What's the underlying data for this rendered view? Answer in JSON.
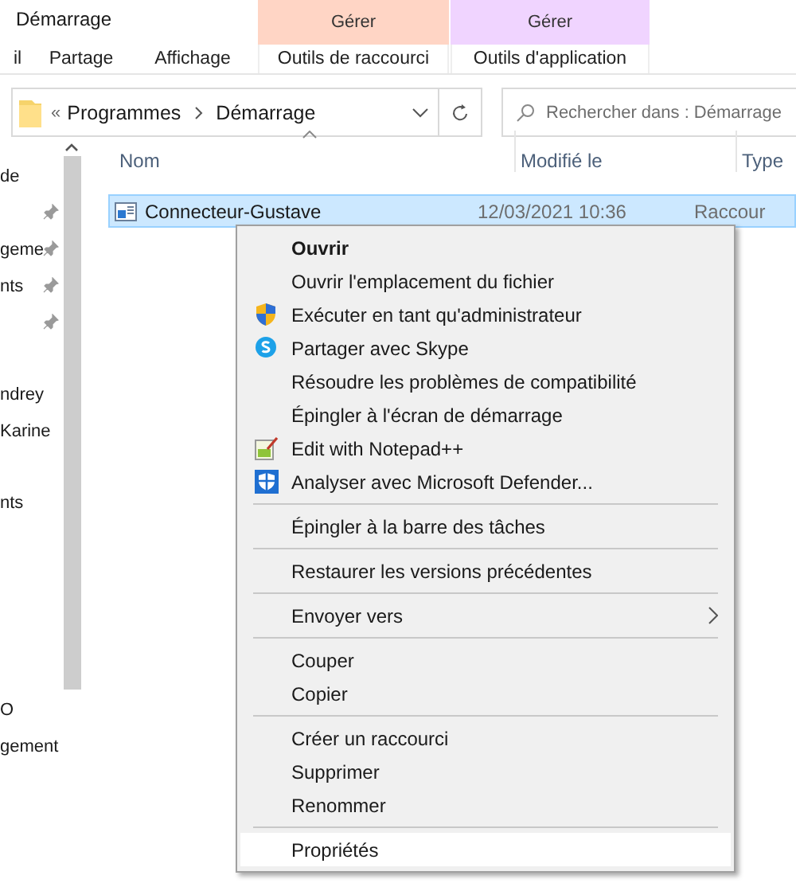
{
  "window": {
    "title": "Démarrage"
  },
  "ribbon": {
    "tabs": [
      {
        "label": "il",
        "selected": false
      },
      {
        "label": "Partage",
        "selected": false
      },
      {
        "label": "Affichage",
        "selected": false
      },
      {
        "label": "Outils de raccourci",
        "selected": false,
        "group": "Gérer",
        "color": "#ffd5c5"
      },
      {
        "label": "Outils d'application",
        "selected": false,
        "group": "Gérer",
        "color": "#f0d4ff"
      }
    ]
  },
  "address": {
    "overflow": "«",
    "crumbs": [
      "Programmes",
      "Démarrage"
    ]
  },
  "search": {
    "placeholder": "Rechercher dans : Démarrage"
  },
  "nav": {
    "groups": [
      [
        {
          "label": "de",
          "pinned": false
        },
        {
          "pinned": true
        },
        {
          "label": "geme",
          "pinned": true
        },
        {
          "label": "nts",
          "pinned": true
        },
        {
          "pinned": true
        }
      ],
      [
        {
          "label": "ndrey",
          "pinned": false
        },
        {
          "label": "Karine",
          "pinned": false
        }
      ],
      [
        {
          "label": "nts",
          "pinned": false
        }
      ],
      [
        {
          "label": "O",
          "pinned": false
        },
        {
          "label": "gement",
          "pinned": false
        }
      ]
    ]
  },
  "table": {
    "columns": [
      {
        "label": "Nom",
        "sorted": true
      },
      {
        "label": "Modifié le",
        "sorted": false
      },
      {
        "label": "Type",
        "sorted": false
      }
    ],
    "rows": [
      {
        "name": "Connecteur-Gustave",
        "modified": "12/03/2021 10:36",
        "type": "Raccour",
        "selected": true
      }
    ]
  },
  "context_menu": {
    "items": [
      {
        "kind": "command",
        "label": "Ouvrir",
        "default": true,
        "selected": false
      },
      {
        "kind": "command",
        "label": "Ouvrir l'emplacement du fichier",
        "default": false,
        "selected": false
      },
      {
        "kind": "admin",
        "label": "Exécuter en tant qu'administrateur",
        "default": false,
        "selected": false
      },
      {
        "kind": "share",
        "label": "Partager avec Skype",
        "default": false,
        "selected": false
      },
      {
        "kind": "command",
        "label": "Résoudre les problèmes de compatibilité",
        "default": false,
        "selected": false
      },
      {
        "kind": "command",
        "label": "Épingler à l'écran de démarrage",
        "default": false,
        "selected": false
      },
      {
        "kind": "edit",
        "label": "Edit with Notepad++",
        "default": false,
        "selected": false
      },
      {
        "kind": "scan",
        "label": "Analyser avec Microsoft Defender...",
        "default": false,
        "selected": false
      },
      {
        "kind": "separator"
      },
      {
        "kind": "command",
        "label": "Épingler à la barre des tâches",
        "default": false,
        "selected": false
      },
      {
        "kind": "separator"
      },
      {
        "kind": "command",
        "label": "Restaurer les versions précédentes",
        "default": false,
        "selected": false
      },
      {
        "kind": "separator"
      },
      {
        "kind": "submenu",
        "label": "Envoyer vers",
        "default": false,
        "selected": false
      },
      {
        "kind": "separator"
      },
      {
        "kind": "command",
        "label": "Couper",
        "default": false,
        "selected": false
      },
      {
        "kind": "command",
        "label": "Copier",
        "default": false,
        "selected": false
      },
      {
        "kind": "separator"
      },
      {
        "kind": "command",
        "label": "Créer un raccourci",
        "default": false,
        "selected": false
      },
      {
        "kind": "command",
        "label": "Supprimer",
        "default": false,
        "selected": false
      },
      {
        "kind": "command",
        "label": "Renommer",
        "default": false,
        "selected": false
      },
      {
        "kind": "separator"
      },
      {
        "kind": "command",
        "label": "Propriétés",
        "default": false,
        "selected": true
      }
    ]
  }
}
